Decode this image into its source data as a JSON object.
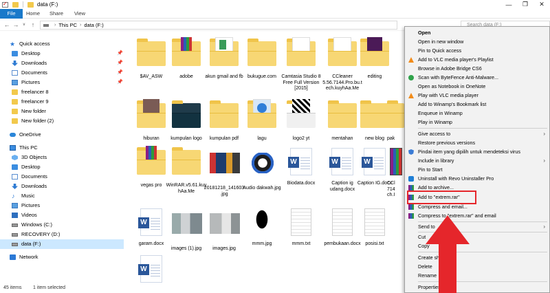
{
  "window": {
    "title": "data (F:)",
    "minimize_glyph": "—",
    "restore_glyph": "❐",
    "close_glyph": "✕"
  },
  "ribbon": {
    "tabs": [
      "File",
      "Home",
      "Share",
      "View"
    ]
  },
  "address": {
    "path": [
      "This PC",
      "data (F:)"
    ],
    "search_placeholder": "Search data (F:)"
  },
  "nav": {
    "items": [
      {
        "label": "Quick access",
        "icon": "star-icon"
      },
      {
        "label": "Desktop",
        "icon": "desktop-icon",
        "pinned": true
      },
      {
        "label": "Downloads",
        "icon": "download-icon",
        "pinned": true
      },
      {
        "label": "Documents",
        "icon": "documents-icon",
        "pinned": true
      },
      {
        "label": "Pictures",
        "icon": "pictures-icon",
        "pinned": true
      },
      {
        "label": "freelancer 8",
        "icon": "folder-icon"
      },
      {
        "label": "freelancer 9",
        "icon": "folder-icon"
      },
      {
        "label": "New folder",
        "icon": "folder-icon"
      },
      {
        "label": "New folder (2)",
        "icon": "folder-icon"
      },
      {
        "label": "OneDrive",
        "icon": "cloud-icon"
      },
      {
        "label": "This PC",
        "icon": "pc-icon"
      },
      {
        "label": "3D Objects",
        "icon": "3d-objects-icon"
      },
      {
        "label": "Desktop",
        "icon": "desktop-icon"
      },
      {
        "label": "Documents",
        "icon": "documents-icon"
      },
      {
        "label": "Downloads",
        "icon": "download-icon"
      },
      {
        "label": "Music",
        "icon": "music-icon"
      },
      {
        "label": "Pictures",
        "icon": "pictures-icon"
      },
      {
        "label": "Videos",
        "icon": "videos-icon"
      },
      {
        "label": "Windows (C:)",
        "icon": "drive-icon"
      },
      {
        "label": "RECOVERY (D:)",
        "icon": "drive-icon"
      },
      {
        "label": "data (F:)",
        "icon": "drive-icon",
        "selected": true
      },
      {
        "label": "Network",
        "icon": "network-icon"
      }
    ]
  },
  "files": [
    {
      "label": "$AV_ASW",
      "type": "folder"
    },
    {
      "label": "adobe",
      "type": "folder"
    },
    {
      "label": "akun gmail and fb",
      "type": "folder-doc"
    },
    {
      "label": "bukugue.com",
      "type": "folder"
    },
    {
      "label": "Camtasia Studio 8 Free Full Version [2015]",
      "type": "folder-doc"
    },
    {
      "label": "CCleaner 5.56.7144.Pro.bu.tech.kuyhAa.Me",
      "type": "folder-doc"
    },
    {
      "label": "editing",
      "type": "folder-premiere"
    },
    {
      "label": "hiburan",
      "type": "folder-photo"
    },
    {
      "label": "kumpulan logo",
      "type": "folder-dark"
    },
    {
      "label": "kumpulan pdf",
      "type": "folder"
    },
    {
      "label": "lagu",
      "type": "folder-disc"
    },
    {
      "label": "logo2 yt",
      "type": "folder-logos"
    },
    {
      "label": "mentahan",
      "type": "folder"
    },
    {
      "label": "new blog",
      "type": "folder"
    },
    {
      "label": "vegas pro",
      "type": "folder-rar"
    },
    {
      "label": "WinRAR.v5.61.kuyhAa.Me",
      "type": "folder"
    },
    {
      "label": "20181218_141603.jpg",
      "type": "image-banner"
    },
    {
      "label": "Audio dakwah.jpg",
      "type": "image-circle"
    },
    {
      "label": "Biodata.docx",
      "type": "docx"
    },
    {
      "label": "Caption ig udang.docx",
      "type": "docx"
    },
    {
      "label": "Caption IG.docx",
      "type": "docx"
    },
    {
      "label": "garam.docx",
      "type": "docx"
    },
    {
      "label": "images (1).jpg",
      "type": "image-gray"
    },
    {
      "label": "images.jpg",
      "type": "image-gray"
    },
    {
      "label": "mmm.jpg",
      "type": "image-silhouette"
    },
    {
      "label": "mmm.txt",
      "type": "txt"
    },
    {
      "label": "pembukaan.docx",
      "type": "txt"
    },
    {
      "label": "posisi.txt",
      "type": "txt"
    },
    {
      "label": "",
      "type": "docx"
    }
  ],
  "partially_hidden": {
    "pak": "pak",
    "cc": "CCl",
    "cc2": "714",
    "cc3": "ch.I"
  },
  "status": {
    "count": "45 items",
    "selection": "1 item selected"
  },
  "context_menu": {
    "items": [
      {
        "label": "Open",
        "bold": true
      },
      {
        "label": "Open in new window"
      },
      {
        "label": "Pin to Quick access"
      },
      {
        "label": "Add to VLC media player's Playlist",
        "icon": "vlc-icon"
      },
      {
        "label": "Browse in Adobe Bridge CS6"
      },
      {
        "label": "Scan with ByteFence Anti-Malware...",
        "icon": "bytefence-icon"
      },
      {
        "label": "Open as Notebook in OneNote"
      },
      {
        "label": "Play with VLC media player",
        "icon": "vlc-icon"
      },
      {
        "label": "Add to Winamp's Bookmark list"
      },
      {
        "label": "Enqueue in Winamp"
      },
      {
        "label": "Play in Winamp"
      },
      {
        "label": "Give access to",
        "submenu": true
      },
      {
        "label": "Restore previous versions"
      },
      {
        "label": "Pindai item yang dipilih untuk mendeteksi virus",
        "icon": "shield-icon"
      },
      {
        "label": "Include in library",
        "submenu": true
      },
      {
        "label": "Pin to Start"
      },
      {
        "label": "Uninstall with Revo Uninstaller Pro",
        "icon": "revo-icon"
      },
      {
        "label": "Add to archive...",
        "icon": "winrar-icon"
      },
      {
        "label": "Add to \"extrem.rar\"",
        "icon": "winrar-icon"
      },
      {
        "label": "Compress and email...",
        "icon": "winrar-icon"
      },
      {
        "label": "Compress to \"extrem.rar\" and email",
        "icon": "winrar-icon"
      },
      {
        "label": "Send to",
        "submenu": true
      },
      {
        "label": "Cut"
      },
      {
        "label": "Copy"
      },
      {
        "label": "Create shortcut"
      },
      {
        "label": "Delete"
      },
      {
        "label": "Rename"
      },
      {
        "label": "Properties"
      }
    ]
  },
  "colors": {
    "accent": "#1979ca",
    "highlight": "#e5262b",
    "selection": "#cce8ff"
  }
}
